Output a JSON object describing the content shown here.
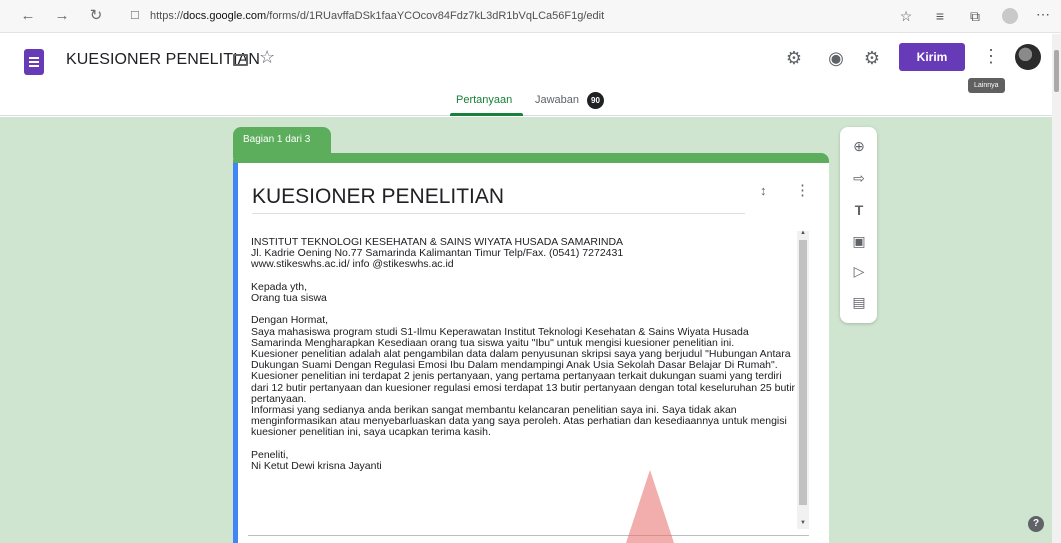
{
  "browser": {
    "url_prefix": "https://",
    "url_host": "docs.google.com",
    "url_path": "/forms/d/1RUavffaDSk1faaYCOcov84Fdz7kL3dR1bVqLCa56F1g/edit"
  },
  "header": {
    "title": "KUESIONER PENELITIAN",
    "send_label": "Kirim",
    "more_tooltip": "Lainnya",
    "tabs": [
      {
        "label": "Pertanyaan"
      },
      {
        "label": "Jawaban"
      }
    ],
    "responses_count": "90"
  },
  "section": {
    "label": "Bagian 1 dari 3"
  },
  "form": {
    "title": "KUESIONER PENELITIAN",
    "description": "INSTITUT TEKNOLOGI KESEHATAN & SAINS WIYATA HUSADA SAMARINDA\nJl. Kadrie Oening No.77 Samarinda Kalimantan Timur Telp/Fax. (0541) 7272431\nwww.stikeswhs.ac.id/ info @stikeswhs.ac.id\n\nKepada yth,\nOrang tua siswa\n\nDengan Hormat,\nSaya mahasiswa program studi S1-Ilmu Keperawatan Institut Teknologi Kesehatan & Sains Wiyata Husada Samarinda Mengharapkan Kesediaan orang tua siswa yaitu \"Ibu\" untuk mengisi kuesioner penelitian ini.\nKuesioner penelitian adalah alat pengambilan data dalam penyusunan skripsi saya yang berjudul \"Hubungan Antara Dukungan Suami Dengan Regulasi Emosi Ibu Dalam mendampingi Anak Usia Sekolah Dasar Belajar Di Rumah\". Kuesioner penelitian ini terdapat 2 jenis pertanyaan, yang pertama pertanyaan terkait dukungan suami yang terdiri dari 12 butir pertanyaan dan kuesioner regulasi emosi terdapat 13 butir pertanyaan dengan total keseluruhan 25 butir pertanyaan.\nInformasi yang sedianya anda berikan sangat membantu kelancaran penelitian saya ini. Saya tidak akan menginformasikan atau menyebarluaskan data yang saya peroleh. Atas perhatian dan kesediaannya untuk mengisi kuesioner penelitian ini, saya ucapkan terima kasih.\n\nPeneliti,\nNi Ketut Dewi krisna Jayanti"
  },
  "colors": {
    "theme": "#5cad5c",
    "canvas": "#cfe5cf",
    "brand": "#673ab7",
    "active_tab": "#188038"
  }
}
